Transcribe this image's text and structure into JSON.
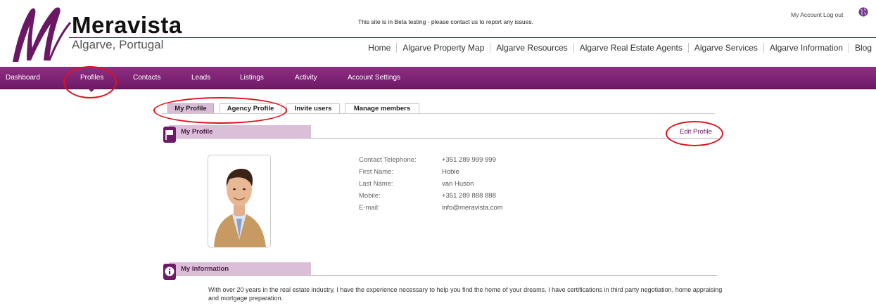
{
  "header": {
    "brand_name": "Meravista",
    "brand_sub": "Algarve, Portugal",
    "beta_notice": "This site is in Beta testing - please contact us to report any issues.",
    "my_account": "My Account",
    "log_out": "Log out"
  },
  "topnav": [
    "Home",
    "Algarve Property Map",
    "Algarve Resources",
    "Algarve Real Estate Agents",
    "Algarve Services",
    "Algarve Information",
    "Blog"
  ],
  "mainnav": [
    "Dashboard",
    "Profiles",
    "Contacts",
    "Leads",
    "Listings",
    "Activity",
    "Account Settings"
  ],
  "tabs": [
    "My Profile",
    "Agency Profile",
    "Invite users",
    "Manage members"
  ],
  "profile_section": {
    "title": "My Profile",
    "edit_label": "Edit Profile"
  },
  "details": [
    {
      "label": "Contact Telephone:",
      "value": "+351 289 999 999"
    },
    {
      "label": "First Name:",
      "value": "Hobie"
    },
    {
      "label": "Last Name:",
      "value": "van Huson"
    },
    {
      "label": "Mobile:",
      "value": "+351 289 888 888"
    },
    {
      "label": "E-mail:",
      "value": "info@meravista.com"
    }
  ],
  "info_section": {
    "title": "My Information",
    "body": "With over 20 years in the real estate industry, I have the experience necessary to help you find the home of your dreams. I have certifications in third party negotiation, home appraising and mortgage preparation."
  },
  "colors": {
    "brand_purple": "#7a1f70",
    "tab_active": "#d9bcd6",
    "annotation_red": "#e0121b"
  }
}
